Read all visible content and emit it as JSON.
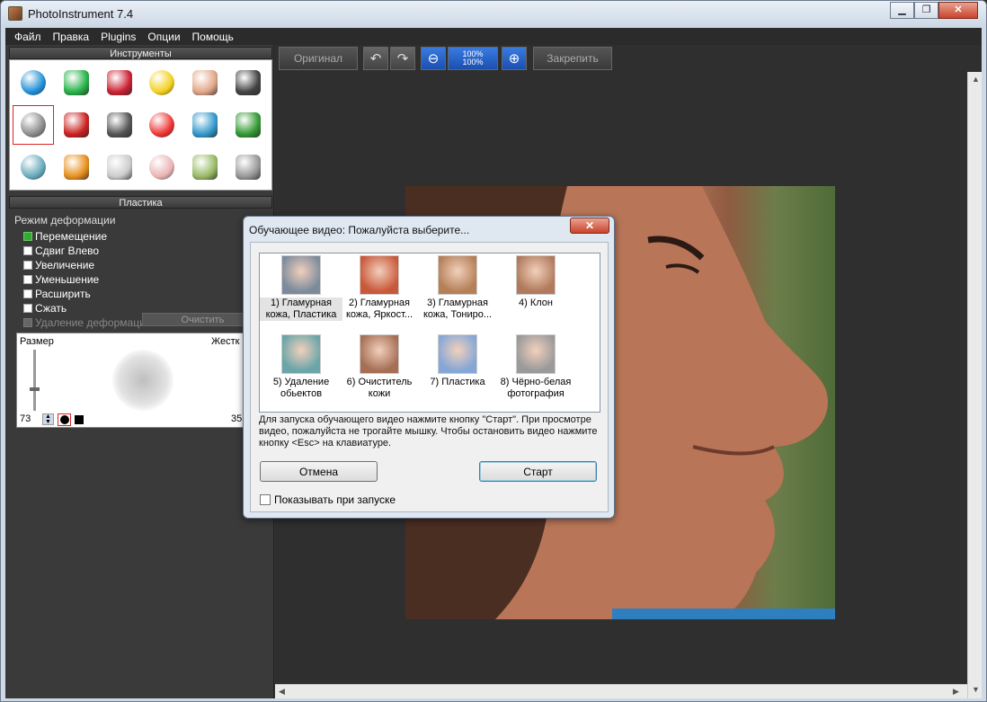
{
  "window": {
    "title": "PhotoInstrument 7.4",
    "min_glyph": "▁",
    "max_glyph": "❐",
    "close_glyph": "✕"
  },
  "menu": [
    "Файл",
    "Правка",
    "Plugins",
    "Опции",
    "Помощь"
  ],
  "tools_panel": {
    "title": "Инструменты",
    "tools": [
      {
        "name": "water-drop-icon",
        "color": "#1f8fd6"
      },
      {
        "name": "cone-icon",
        "color": "#29b34a"
      },
      {
        "name": "pencils-icon",
        "color": "#c23"
      },
      {
        "name": "stamp-icon",
        "color": "#f2d01c"
      },
      {
        "name": "finger-icon",
        "color": "#e2a889"
      },
      {
        "name": "pin-icon",
        "color": "#444"
      },
      {
        "name": "shield-icon",
        "color": "#8a8a8a",
        "selected": true
      },
      {
        "name": "eye-icon",
        "color": "#c22"
      },
      {
        "name": "gradient-icon",
        "color": "#555"
      },
      {
        "name": "palette-icon",
        "color": "#e33"
      },
      {
        "name": "lines-icon",
        "color": "#39c"
      },
      {
        "name": "clone-scissors-icon",
        "color": "#393"
      },
      {
        "name": "brush-icon",
        "color": "#6ab"
      },
      {
        "name": "bottle-icon",
        "color": "#e8901e"
      },
      {
        "name": "bulb-icon",
        "color": "#ccc"
      },
      {
        "name": "eraser-icon",
        "color": "#eab4b4"
      },
      {
        "name": "tv-icon",
        "color": "#9b6"
      },
      {
        "name": "text-icon",
        "color": "#999"
      }
    ]
  },
  "plastic_panel": {
    "title": "Пластика",
    "mode_label": "Режим деформации",
    "options": [
      {
        "label": "Перемещение",
        "checked": true
      },
      {
        "label": "Сдвиг Влево",
        "checked": false
      },
      {
        "label": "Увеличение",
        "checked": false
      },
      {
        "label": "Уменьшение",
        "checked": false
      },
      {
        "label": "Расширить",
        "checked": false
      },
      {
        "label": "Сжать",
        "checked": false
      }
    ],
    "undo_label": "Удаление деформации",
    "clear_label": "Очистить",
    "size_label": "Размер",
    "hardness_label": "Жестк",
    "size_value": "73",
    "hardness_value": "35"
  },
  "toolbar": {
    "original_label": "Оригинал",
    "zoom_100_top": "100%",
    "zoom_100_bottom": "100%",
    "fix_label": "Закрепить"
  },
  "dialog": {
    "title": "Обучающее видео: Пожалуйста выберите...",
    "close": "✕",
    "videos": [
      {
        "label": "1) Гламурная кожа, Пластика",
        "thumb": "#7c8b9c",
        "selected": true
      },
      {
        "label": "2) Гламурная кожа, Яркост...",
        "thumb": "#c9583a"
      },
      {
        "label": "3) Гламурная кожа, Тониро...",
        "thumb": "#b58058"
      },
      {
        "label": "4) Клон",
        "thumb": "#b17a5c"
      },
      {
        "label": "5) Удаление обьектов",
        "thumb": "#6aa5a8"
      },
      {
        "label": "6) Очиститель кожи",
        "thumb": "#a66f55"
      },
      {
        "label": "7) Пластика",
        "thumb": "#86a7d6"
      },
      {
        "label": "8) Чёрно-белая фотография",
        "thumb": "#9a9a9a"
      }
    ],
    "info": "Для запуска обучающего видео нажмите кнопку \"Старт\". При просмотре видео, пожалуйста не трогайте мышку. Чтобы остановить видео нажмите кнопку <Esc> на клавиатуре.",
    "cancel_label": "Отмена",
    "start_label": "Старт",
    "show_on_start_label": "Показывать при запуске"
  }
}
